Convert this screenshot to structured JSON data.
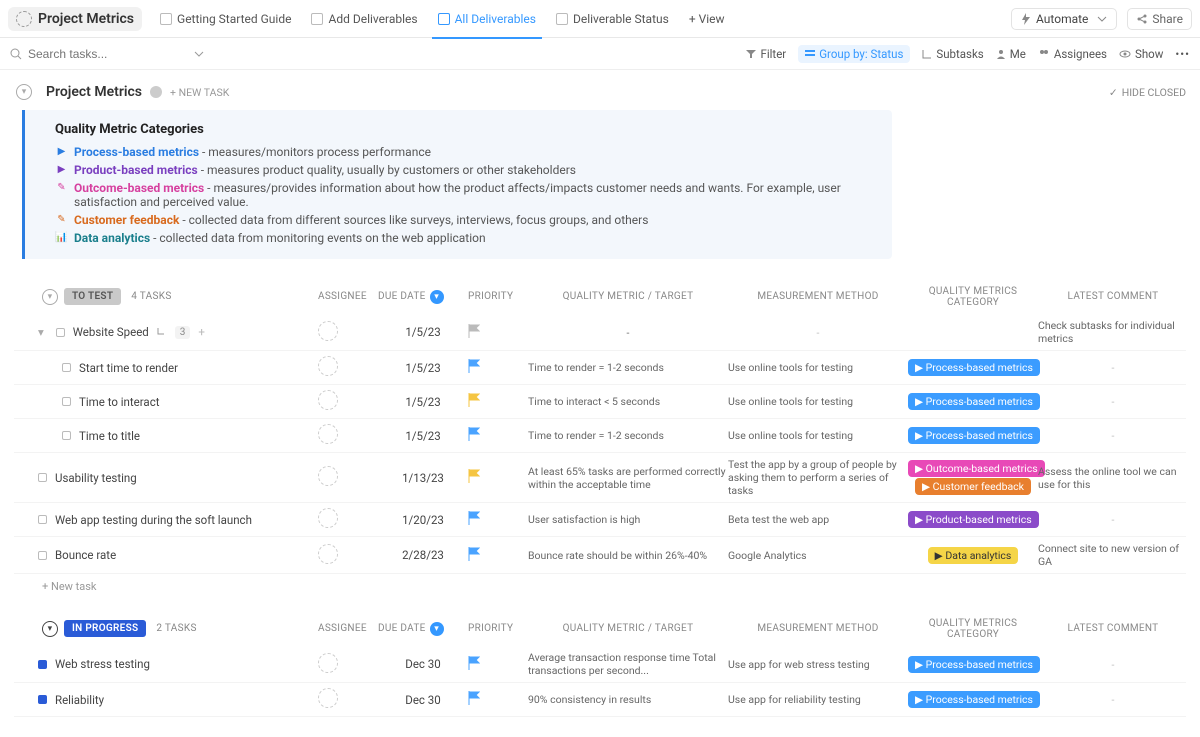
{
  "header": {
    "title": "Project Metrics",
    "tabs": [
      {
        "label": "Getting Started Guide"
      },
      {
        "label": "Add Deliverables"
      },
      {
        "label": "All Deliverables",
        "active": true
      },
      {
        "label": "Deliverable Status"
      }
    ],
    "view_btn": "+ View",
    "automate": "Automate",
    "share": "Share"
  },
  "filterbar": {
    "search_placeholder": "Search tasks...",
    "filter": "Filter",
    "group": "Group by: Status",
    "subtasks": "Subtasks",
    "me": "Me",
    "assignees": "Assignees",
    "show": "Show"
  },
  "list": {
    "title": "Project Metrics",
    "new_task": "+ NEW TASK",
    "hide_closed": "HIDE CLOSED"
  },
  "info": {
    "heading": "Quality Metric Categories",
    "items": [
      {
        "name": "Process-based metrics",
        "color": "#2a7de1",
        "icon": "▶",
        "desc": "- measures/monitors process performance"
      },
      {
        "name": "Product-based metrics",
        "color": "#7a3fbf",
        "icon": "▶",
        "desc": "- measures product quality, usually by  customers or other stakeholders"
      },
      {
        "name": "Outcome-based metrics",
        "color": "#d6409f",
        "icon": "✎",
        "desc": "- measures/provides information about how the product affects/impacts customer needs and wants. For example, user satisfaction and perceived value."
      },
      {
        "name": "Customer feedback",
        "color": "#d86a1e",
        "icon": "✎",
        "desc": "- collected data from different sources like surveys, interviews, focus groups, and others"
      },
      {
        "name": "Data analytics",
        "color": "#1a7f8c",
        "icon": "📊",
        "desc": "- collected data from monitoring events on the web application"
      }
    ]
  },
  "columns": [
    "ASSIGNEE",
    "DUE DATE",
    "PRIORITY",
    "QUALITY METRIC / TARGET",
    "MEASUREMENT METHOD",
    "QUALITY METRICS CATEGORY",
    "LATEST COMMENT"
  ],
  "groups": [
    {
      "status": "TO TEST",
      "status_color": "#c9c9c9",
      "count": "4 TASKS",
      "rows": [
        {
          "name": "Website Speed",
          "subcount": "3",
          "due": "1/5/23",
          "flag": "#bbb",
          "target": "-",
          "method": "-",
          "metric": null,
          "comment": "Check subtasks for individual metrics",
          "parent": true
        },
        {
          "name": "Start time to render",
          "due": "1/5/23",
          "flag": "#4aa3ff",
          "target": "Time to render = 1-2 seconds",
          "method": "Use online tools for testing",
          "metric": {
            "text": "Process-based metrics",
            "cls": "mp-blue"
          },
          "comment": "-",
          "sub": true
        },
        {
          "name": "Time to interact",
          "due": "1/5/23",
          "flag": "#f5c542",
          "target": "Time to interact < 5 seconds",
          "method": "Use online tools for testing",
          "metric": {
            "text": "Process-based metrics",
            "cls": "mp-blue"
          },
          "comment": "-",
          "sub": true
        },
        {
          "name": "Time to title",
          "due": "1/5/23",
          "flag": "#4aa3ff",
          "target": "Time to render = 1-2 seconds",
          "method": "Use online tools for testing",
          "metric": {
            "text": "Process-based metrics",
            "cls": "mp-blue"
          },
          "comment": "-",
          "sub": true
        },
        {
          "name": "Usability testing",
          "due": "1/13/23",
          "flag": "#f5c542",
          "target": "At least 65% tasks are performed correctly within the acceptable time",
          "method": "Test the app by a group of people by asking them to perform a series of tasks",
          "metrics": [
            {
              "text": "Outcome-based metrics",
              "cls": "mp-pink"
            },
            {
              "text": "Customer feedback",
              "cls": "mp-orange"
            }
          ],
          "comment": "Assess the online tool we can use for this"
        },
        {
          "name": "Web app testing during the soft launch",
          "due": "1/20/23",
          "flag": "#4aa3ff",
          "target": "User satisfaction is high",
          "method": "Beta test the web app",
          "metric": {
            "text": "Product-based metrics",
            "cls": "mp-purple"
          },
          "comment": "-"
        },
        {
          "name": "Bounce rate",
          "due": "2/28/23",
          "flag": "#4aa3ff",
          "target": "Bounce rate should be within 26%-40%",
          "method": "Google Analytics",
          "metric": {
            "text": "Data analytics",
            "cls": "mp-yellow"
          },
          "comment": "Connect site to new version of GA"
        }
      ],
      "new_task": "+ New task"
    },
    {
      "status": "IN PROGRESS",
      "status_color": "#2a5bd7",
      "count": "2 TASKS",
      "rows": [
        {
          "name": "Web stress testing",
          "due": "Dec 30",
          "flag": "#4aa3ff",
          "target": "Average transaction response time Total transactions per second...",
          "method": "Use app for web stress testing",
          "metric": {
            "text": "Process-based metrics",
            "cls": "mp-blue"
          },
          "comment": "-",
          "inprog": true
        },
        {
          "name": "Reliability",
          "due": "Dec 30",
          "flag": "#4aa3ff",
          "target": "90% consistency in results",
          "method": "Use app for reliability testing",
          "metric": {
            "text": "Process-based metrics",
            "cls": "mp-blue"
          },
          "comment": "-",
          "inprog": true
        }
      ]
    }
  ]
}
